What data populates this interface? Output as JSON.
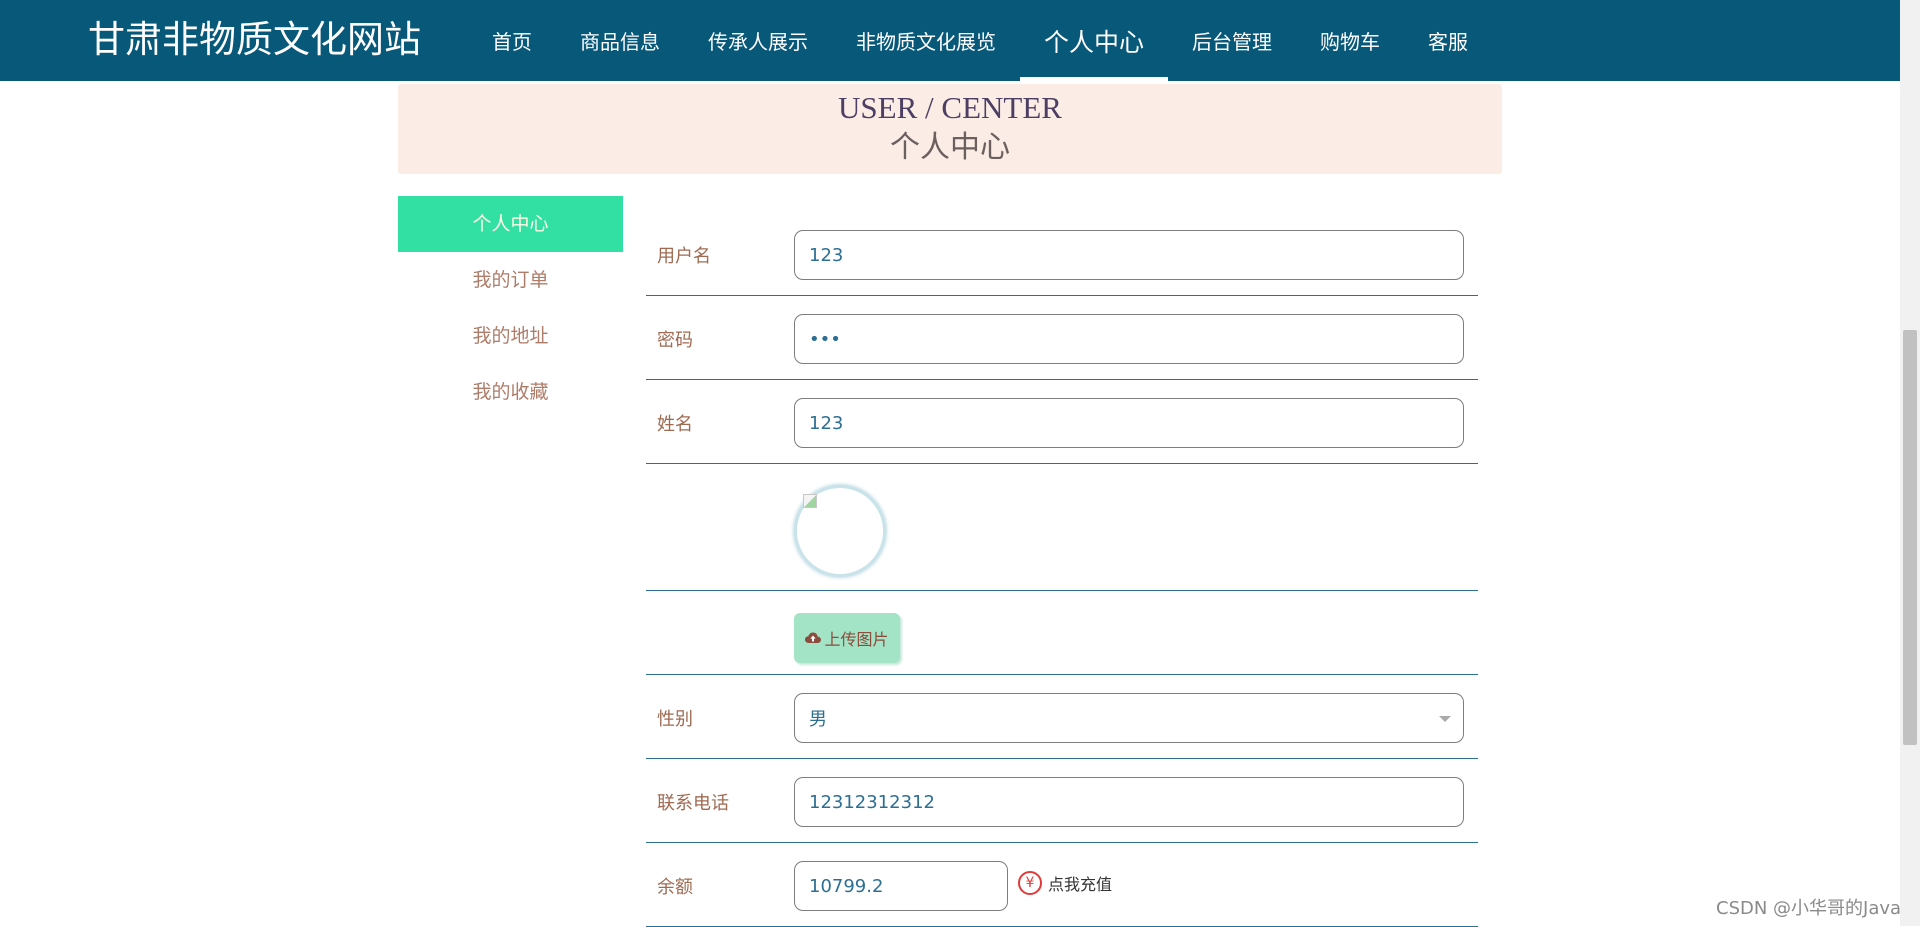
{
  "site": {
    "title": "甘肃非物质文化网站"
  },
  "nav": {
    "items": [
      {
        "label": "首页"
      },
      {
        "label": "商品信息"
      },
      {
        "label": "传承人展示"
      },
      {
        "label": "非物质文化展览"
      },
      {
        "label": "个人中心",
        "active": true
      },
      {
        "label": "后台管理"
      },
      {
        "label": "购物车"
      },
      {
        "label": "客服"
      }
    ]
  },
  "banner": {
    "title_en": "USER / CENTER",
    "title_cn": "个人中心"
  },
  "sidebar": {
    "items": [
      {
        "label": "个人中心",
        "active": true
      },
      {
        "label": "我的订单"
      },
      {
        "label": "我的地址"
      },
      {
        "label": "我的收藏"
      }
    ]
  },
  "form": {
    "username": {
      "label": "用户名",
      "value": "123"
    },
    "password": {
      "label": "密码",
      "value": "•••"
    },
    "name": {
      "label": "姓名",
      "value": "123"
    },
    "upload": {
      "label": "上传图片",
      "icon": "cloud-upload-icon"
    },
    "gender": {
      "label": "性别",
      "value": "男"
    },
    "phone": {
      "label": "联系电话",
      "value": "12312312312"
    },
    "balance": {
      "label": "余额",
      "value": "10799.2",
      "recharge_label": "点我充值",
      "recharge_icon": "yen-icon"
    }
  },
  "colors": {
    "nav_bg": "#08587a",
    "sidebar_active": "#33e0a4",
    "banner_bg": "#fbede6",
    "label_text": "#a06a52",
    "field_text": "#2d6f93",
    "upload_bg": "#a3e3c6"
  },
  "watermark": "CSDN @小华哥的Java"
}
